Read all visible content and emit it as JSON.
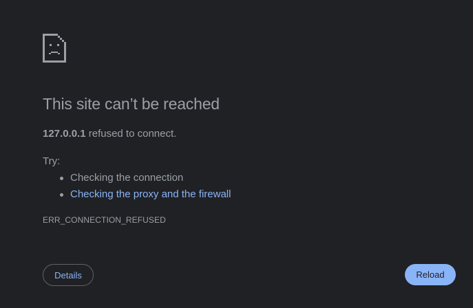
{
  "error_page": {
    "icon": "sad-document-icon",
    "title": "This site can’t be reached",
    "host": "127.0.0.1",
    "message": " refused to connect.",
    "try_label": "Try:",
    "suggestions": [
      {
        "label": "Checking the connection",
        "is_link": false
      },
      {
        "label": "Checking the proxy and the firewall",
        "is_link": true
      }
    ],
    "error_code": "ERR_CONNECTION_REFUSED"
  },
  "buttons": {
    "details_label": "Details",
    "reload_label": "Reload"
  },
  "colors": {
    "background": "#202124",
    "text": "#9aa0a6",
    "link": "#8ab4f8",
    "primary_button": "#8ab4f8"
  }
}
